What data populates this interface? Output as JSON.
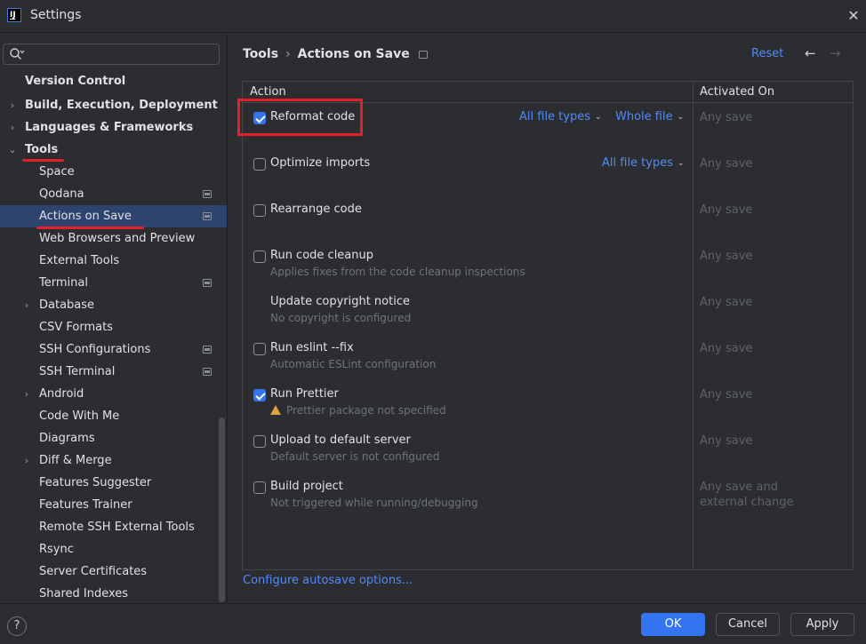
{
  "window": {
    "title": "Settings"
  },
  "search": {
    "placeholder": ""
  },
  "sidebar": {
    "items": [
      {
        "label": "Version Control"
      },
      {
        "label": "Build, Execution, Deployment"
      },
      {
        "label": "Languages & Frameworks"
      },
      {
        "label": "Tools"
      },
      {
        "label": "Space"
      },
      {
        "label": "Qodana"
      },
      {
        "label": "Actions on Save"
      },
      {
        "label": "Web Browsers and Preview"
      },
      {
        "label": "External Tools"
      },
      {
        "label": "Terminal"
      },
      {
        "label": "Database"
      },
      {
        "label": "CSV Formats"
      },
      {
        "label": "SSH Configurations"
      },
      {
        "label": "SSH Terminal"
      },
      {
        "label": "Android"
      },
      {
        "label": "Code With Me"
      },
      {
        "label": "Diagrams"
      },
      {
        "label": "Diff & Merge"
      },
      {
        "label": "Features Suggester"
      },
      {
        "label": "Features Trainer"
      },
      {
        "label": "Remote SSH External Tools"
      },
      {
        "label": "Rsync"
      },
      {
        "label": "Server Certificates"
      },
      {
        "label": "Shared Indexes"
      }
    ]
  },
  "header": {
    "breadcrumb_parent": "Tools",
    "breadcrumb_separator": "›",
    "breadcrumb_current": "Actions on Save",
    "reset_label": "Reset",
    "back_glyph": "←",
    "forward_glyph": "→"
  },
  "table": {
    "col_action": "Action",
    "col_activated": "Activated On",
    "rows": [
      {
        "title": "Reformat code",
        "checked": true,
        "sub": "",
        "dropdown1": "All file types",
        "dropdown2": "Whole file",
        "activated": "Any save"
      },
      {
        "title": "Optimize imports",
        "checked": false,
        "sub": "",
        "dropdown1": "All file types",
        "activated": "Any save"
      },
      {
        "title": "Rearrange code",
        "checked": false,
        "sub": "",
        "activated": "Any save"
      },
      {
        "title": "Run code cleanup",
        "checked": false,
        "sub": "Applies fixes from the code cleanup inspections",
        "activated": "Any save"
      },
      {
        "title": "Update copyright notice",
        "checked": false,
        "sub": "No copyright is configured",
        "activated": "Any save"
      },
      {
        "title": "Run eslint --fix",
        "checked": false,
        "sub": "Automatic ESLint configuration",
        "activated": "Any save"
      },
      {
        "title": "Run Prettier",
        "checked": true,
        "sub": "Prettier package not specified",
        "activated": "Any save"
      },
      {
        "title": "Upload to default server",
        "checked": false,
        "sub": "Default server is not configured",
        "activated": "Any save"
      },
      {
        "title": "Build project",
        "checked": false,
        "sub": "Not triggered while running/debugging",
        "activated_line1": "Any save and",
        "activated_line2": "external change"
      }
    ]
  },
  "config_link": "Configure autosave options...",
  "footer": {
    "help": "?",
    "ok": "OK",
    "cancel": "Cancel",
    "apply": "Apply"
  },
  "colors": {
    "accent": "#3574f0",
    "link": "#548af7",
    "highlight": "#e5202b",
    "selection": "#2e436e"
  }
}
